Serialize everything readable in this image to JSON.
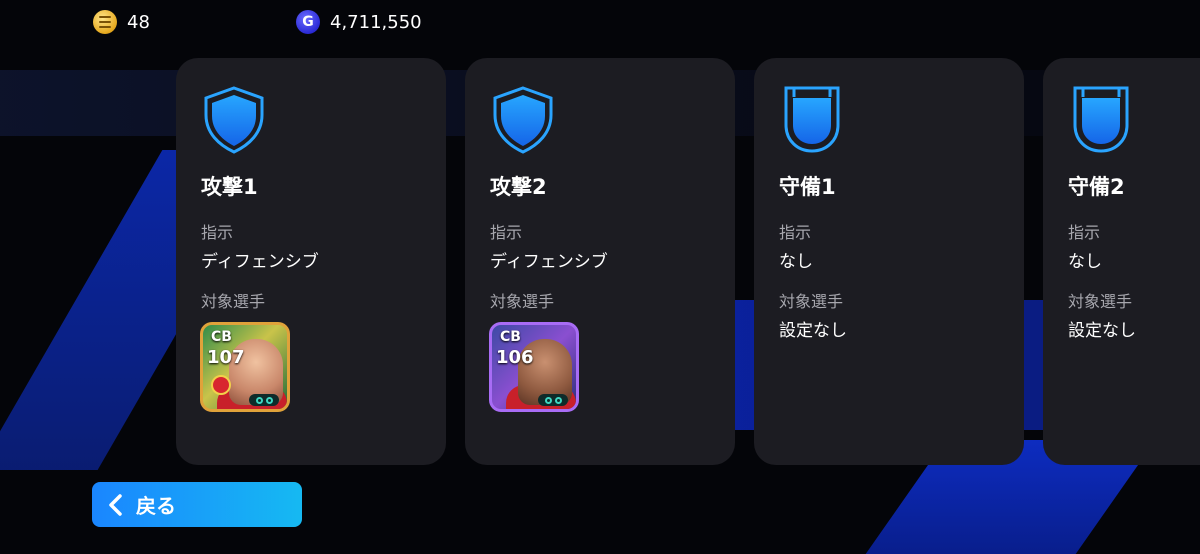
{
  "currency": {
    "coins": "48",
    "gp": "4,711,550",
    "gp_symbol": "G"
  },
  "cards": [
    {
      "title": "攻撃1",
      "instruction_label": "指示",
      "instruction_value": "ディフェンシブ",
      "target_label": "対象選手",
      "player": {
        "position": "CB",
        "rating": "107"
      },
      "shield_style": "pointed"
    },
    {
      "title": "攻撃2",
      "instruction_label": "指示",
      "instruction_value": "ディフェンシブ",
      "target_label": "対象選手",
      "player": {
        "position": "CB",
        "rating": "106"
      },
      "shield_style": "pointed"
    },
    {
      "title": "守備1",
      "instruction_label": "指示",
      "instruction_value": "なし",
      "target_label": "対象選手",
      "target_value": "設定なし",
      "shield_style": "rounded"
    },
    {
      "title": "守備2",
      "instruction_label": "指示",
      "instruction_value": "なし",
      "target_label": "対象選手",
      "target_value": "設定なし",
      "shield_style": "rounded"
    }
  ],
  "back_button": {
    "label": "戻る"
  },
  "colors": {
    "card_bg": "#1c1c22",
    "shield_blue": "#1e90ff",
    "button_start": "#1a86ff",
    "button_end": "#16b9f2"
  }
}
